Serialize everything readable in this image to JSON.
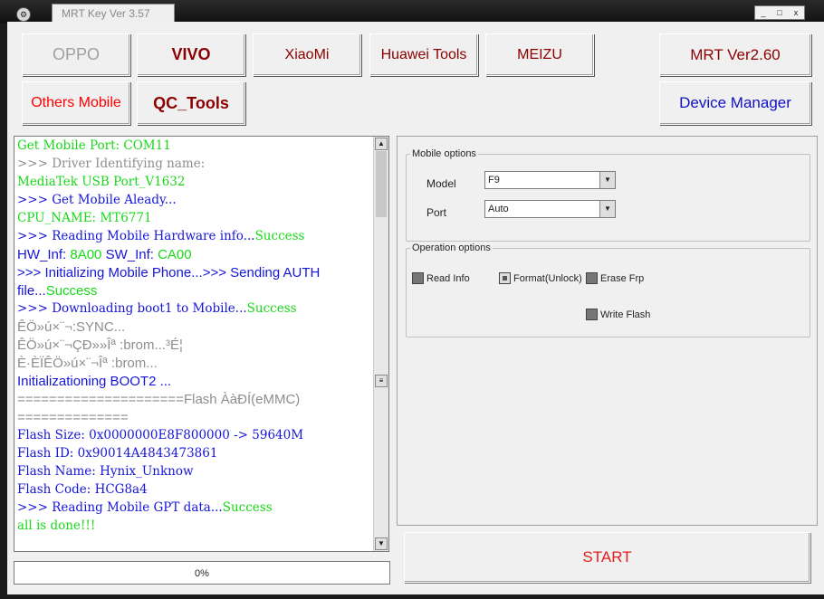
{
  "window": {
    "title": "MRT Key Ver 3.57",
    "controls": [
      "_",
      "□",
      "x"
    ]
  },
  "brand_buttons": [
    {
      "label": "OPPO",
      "color": "#a0a0a0"
    },
    {
      "label": "VIVO",
      "color": "#8b0000"
    },
    {
      "label": "XiaoMi",
      "color": "#8b0000"
    },
    {
      "label": "Huawei Tools",
      "color": "#8b0000"
    },
    {
      "label": "MEIZU",
      "color": "#8b0000"
    },
    {
      "label": "MRT Ver2.60",
      "color": "#8b0000"
    },
    {
      "label": "Others Mobile",
      "color": "#ff0000"
    },
    {
      "label": "QC_Tools",
      "color": "#8b0000"
    },
    {
      "label": "Device Manager",
      "color": "#1010c8"
    }
  ],
  "log": [
    {
      "segments": [
        {
          "text": "    Get Mobile Port:  COM11",
          "c": "g"
        }
      ],
      "font": "mono"
    },
    {
      "segments": [
        {
          "text": ">>> Driver Identifying name:",
          "c": "gr"
        }
      ],
      "font": "mono"
    },
    {
      "segments": [
        {
          "text": "    MediaTek USB Port_V1632",
          "c": "g"
        }
      ],
      "font": "mono"
    },
    {
      "segments": [
        {
          "text": ">>> Get Mobile Aleady...",
          "c": "b"
        }
      ],
      "font": "mono"
    },
    {
      "segments": [
        {
          "text": "    CPU_NAME: MT6771",
          "c": "g"
        }
      ],
      "font": "mono"
    },
    {
      "segments": [
        {
          "text": ">>> Reading Mobile Hardware info...",
          "c": "b"
        },
        {
          "text": "Success",
          "c": "g"
        }
      ],
      "font": "mono"
    },
    {
      "segments": [
        {
          "text": "    HW_Inf: ",
          "c": "b"
        },
        {
          "text": "8A00",
          "c": "g"
        },
        {
          "text": "  SW_Inf: ",
          "c": "b"
        },
        {
          "text": "CA00",
          "c": "g"
        }
      ],
      "font": "sans"
    },
    {
      "segments": [
        {
          "text": ">>> Initializing Mobile Phone...>>> Sending AUTH",
          "c": "b"
        }
      ],
      "font": "sans"
    },
    {
      "segments": [
        {
          "text": "file...",
          "c": "b"
        },
        {
          "text": "Success",
          "c": "g"
        }
      ],
      "font": "sans"
    },
    {
      "segments": [
        {
          "text": ">>> Downloading boot1 to Mobile...",
          "c": "b"
        },
        {
          "text": "Success",
          "c": "g"
        }
      ],
      "font": "mono"
    },
    {
      "segments": [
        {
          "text": "    ÊÖ»ú×¨¬:SYNC...",
          "c": "gr"
        }
      ],
      "font": "sans"
    },
    {
      "segments": [
        {
          "text": "    ÊÖ»ú×¨¬ÇÐ»»Îª :brom...³É¦",
          "c": "gr"
        }
      ],
      "font": "sans"
    },
    {
      "segments": [
        {
          "text": "    È·ÈÏÊÖ»ú×¨¬Îª :brom...",
          "c": "gr"
        }
      ],
      "font": "sans"
    },
    {
      "segments": [
        {
          "text": "  Initializationing BOOT2 ...",
          "c": "b"
        }
      ],
      "font": "sans"
    },
    {
      "segments": [
        {
          "text": "    =====================Flash ÀàÐÍ(eMMC)",
          "c": "gr"
        }
      ],
      "font": "sans"
    },
    {
      "segments": [
        {
          "text": "==============",
          "c": "gr"
        }
      ],
      "font": "sans"
    },
    {
      "segments": [
        {
          "text": "    Flash Size: 0x0000000E8F800000 -> 59640M",
          "c": "b"
        }
      ],
      "font": "mono"
    },
    {
      "segments": [
        {
          "text": "    Flash  ID: 0x90014A4843473861",
          "c": "b"
        }
      ],
      "font": "mono"
    },
    {
      "segments": [
        {
          "text": "    Flash Name: Hynix_Unknow",
          "c": "b"
        }
      ],
      "font": "mono"
    },
    {
      "segments": [
        {
          "text": "    Flash Code: HCG8a4",
          "c": "b"
        }
      ],
      "font": "mono"
    },
    {
      "segments": [
        {
          "text": ">>> Reading Mobile GPT data...",
          "c": "b"
        },
        {
          "text": "Success",
          "c": "g"
        }
      ],
      "font": "mono"
    },
    {
      "segments": [
        {
          "text": "    all is done!!!",
          "c": "g"
        }
      ],
      "font": "mono"
    }
  ],
  "progress": {
    "label": "0%",
    "value": 0
  },
  "mobile_options": {
    "title": "Mobile options",
    "model_label": "Model",
    "model_value": "F9",
    "port_label": "Port",
    "port_value": "Auto"
  },
  "operation_options": {
    "title": "Operation options",
    "items": [
      {
        "label": "Read Info",
        "checked": false
      },
      {
        "label": "Format(Unlock)",
        "checked": true
      },
      {
        "label": "Erase Frp",
        "checked": false
      },
      {
        "label": "Write Flash",
        "checked": false
      }
    ]
  },
  "start_label": "START",
  "icons": {
    "app": "gear-icon",
    "scroll_up": "arrow-up-icon",
    "scroll_down": "arrow-down-icon",
    "dropdown": "chevron-down-icon"
  }
}
